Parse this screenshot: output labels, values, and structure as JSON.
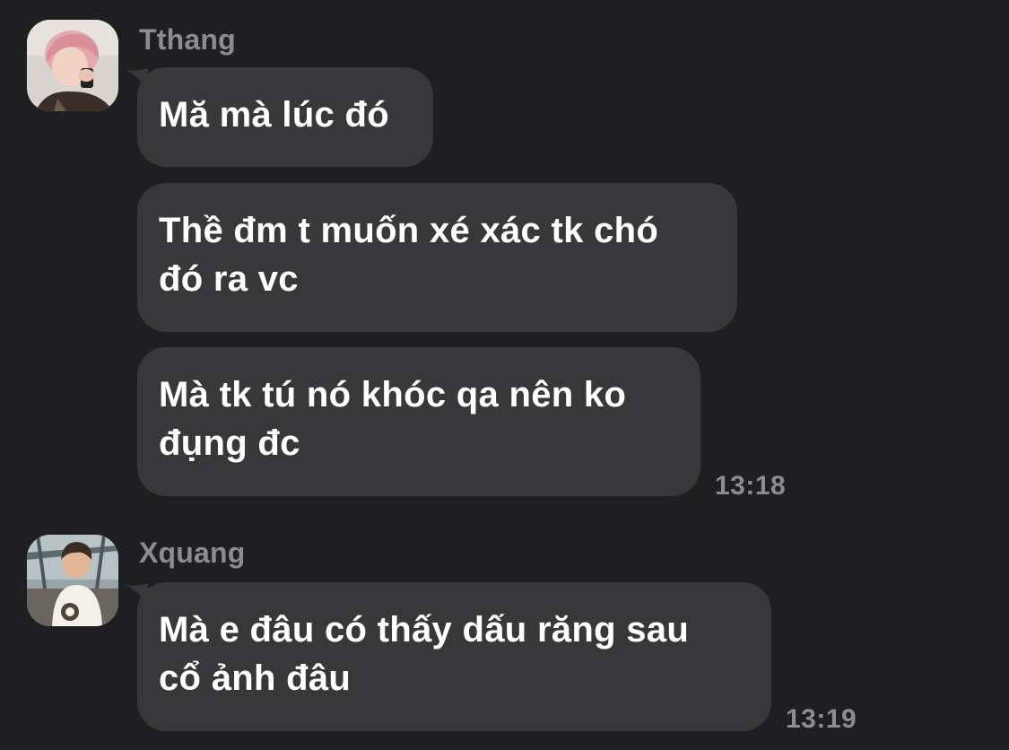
{
  "messages": [
    {
      "sender": "Tthang",
      "avatar_icon": "avatar-tthang",
      "bubbles": [
        {
          "lines": [
            "Mă mà lúc đó"
          ]
        },
        {
          "lines": [
            "Thề đm t muốn xé xác tk chó",
            "đó ra vc"
          ]
        },
        {
          "lines": [
            "Mà tk tú nó khóc qa nên ko",
            "đụng đc"
          ]
        }
      ],
      "time": "13:18"
    },
    {
      "sender": "Xquang",
      "avatar_icon": "avatar-xquang",
      "bubbles": [
        {
          "lines": [
            "Mà e đâu có thấy dấu răng sau",
            "cổ ảnh đâu"
          ]
        }
      ],
      "time": "13:19"
    }
  ],
  "colors": {
    "background": "#1f1f21",
    "bubble": "#38383a",
    "meta_text": "#8c8c91",
    "message_text": "#ffffff"
  }
}
